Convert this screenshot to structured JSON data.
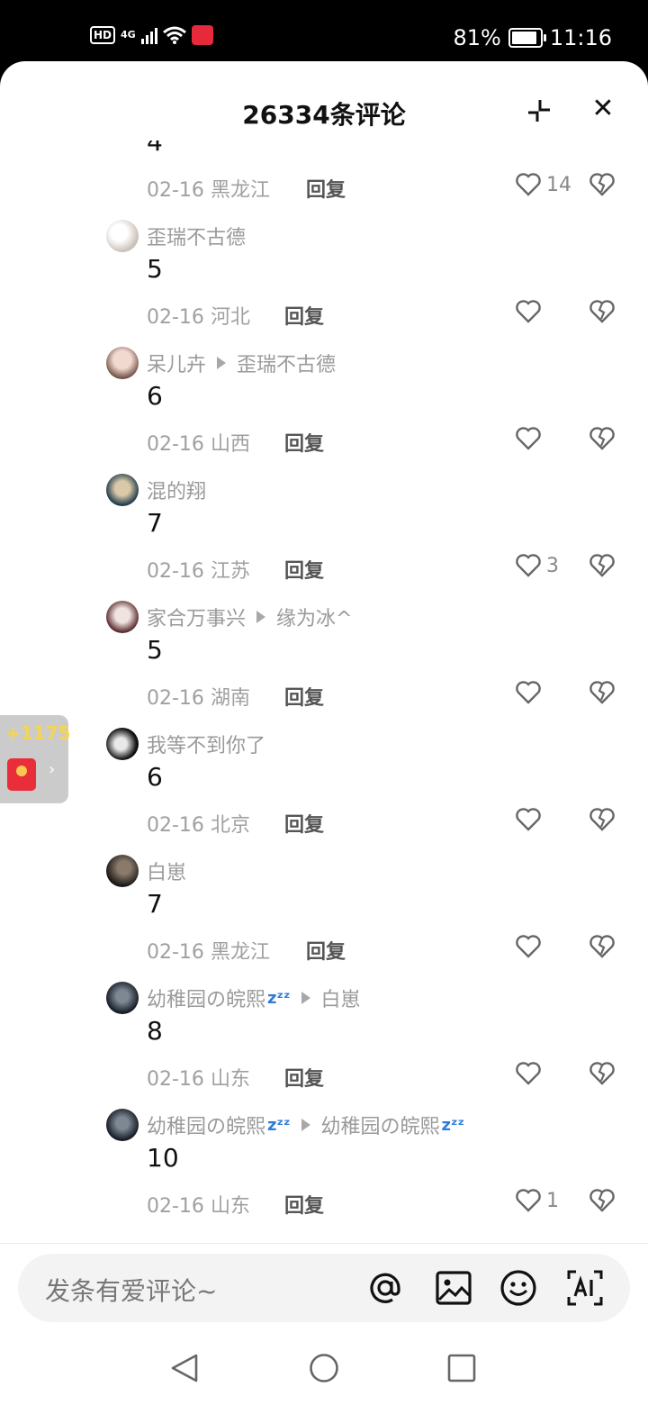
{
  "status_bar": {
    "hd_label": "HD",
    "network_label": "4G",
    "battery_text": "81%",
    "battery_level": 0.81,
    "time": "11:16"
  },
  "header": {
    "title": "26334条评论",
    "collapse_icon": "collapse-icon",
    "close_icon": "close-icon"
  },
  "reply_label": "回复",
  "comments": [
    {
      "author": "",
      "text": "4",
      "date": "02-16",
      "location": "黑龙江",
      "likes": "14"
    },
    {
      "author": "歪瑞不古德",
      "text": "5",
      "date": "02-16",
      "location": "河北",
      "likes": ""
    },
    {
      "author": "呆儿卉",
      "reply_to": "歪瑞不古德",
      "text": "6",
      "date": "02-16",
      "location": "山西",
      "likes": ""
    },
    {
      "author": "混的翔",
      "text": "7",
      "date": "02-16",
      "location": "江苏",
      "likes": "3"
    },
    {
      "author": "家合万事兴",
      "reply_to": "缘为冰^",
      "text": "5",
      "date": "02-16",
      "location": "湖南",
      "likes": ""
    },
    {
      "author": "我等不到你了",
      "text": "6",
      "date": "02-16",
      "location": "北京",
      "likes": ""
    },
    {
      "author": "白崽",
      "text": "7",
      "date": "02-16",
      "location": "黑龙江",
      "likes": ""
    },
    {
      "author": "幼稚园の皖熙",
      "reply_to": "白崽",
      "text": "8",
      "date": "02-16",
      "location": "山东",
      "likes": ""
    },
    {
      "author": "幼稚园の皖熙",
      "reply_to": "幼稚园の皖熙",
      "text": "10",
      "date": "02-16",
      "location": "山东",
      "likes": "1"
    }
  ],
  "red_packet": {
    "count": "+1175"
  },
  "input": {
    "placeholder": "发条有爱评论~",
    "icons": [
      "at-icon",
      "image-icon",
      "emoji-icon",
      "ai-icon"
    ]
  },
  "nav": [
    "back-icon",
    "home-icon",
    "recents-icon"
  ],
  "colors": {
    "accent_zzz": "#2f7bd8",
    "red_packet": "#e8232f"
  }
}
